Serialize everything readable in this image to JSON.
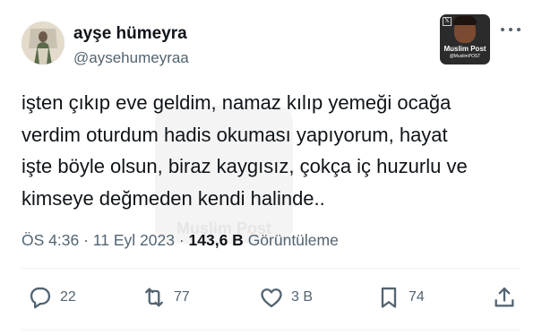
{
  "author": {
    "display_name": "ayşe hümeyra",
    "handle": "@aysehumeyraa"
  },
  "watermark": {
    "title": "Muslim Post",
    "subtitle": "@MuslimPOST",
    "background_text": "Muslim Post"
  },
  "tweet": {
    "lines": [
      "işten çıkıp eve geldim, namaz kılıp yemeği ocağa",
      "verdim oturdum hadis okuması yapıyorum, hayat",
      "işte böyle olsun, biraz kaygısız, çokça iç huzurlu ve",
      "kimseye değmeden kendi halinde.."
    ]
  },
  "meta": {
    "time": "ÖS 4:36",
    "separator": "·",
    "date": "11 Eyl 2023",
    "views": "143,6 B",
    "views_label": "Görüntüleme"
  },
  "actions": {
    "replies": "22",
    "retweets": "77",
    "likes": "3 B",
    "bookmarks": "74"
  },
  "icons": {
    "reply": "reply-icon",
    "retweet": "retweet-icon",
    "like": "heart-icon",
    "bookmark": "bookmark-icon",
    "share": "share-icon",
    "more": "more-icon"
  },
  "colors": {
    "text": "#0f1419",
    "secondary": "#536471",
    "divider": "#eff3f4",
    "background": "#ffffff"
  }
}
